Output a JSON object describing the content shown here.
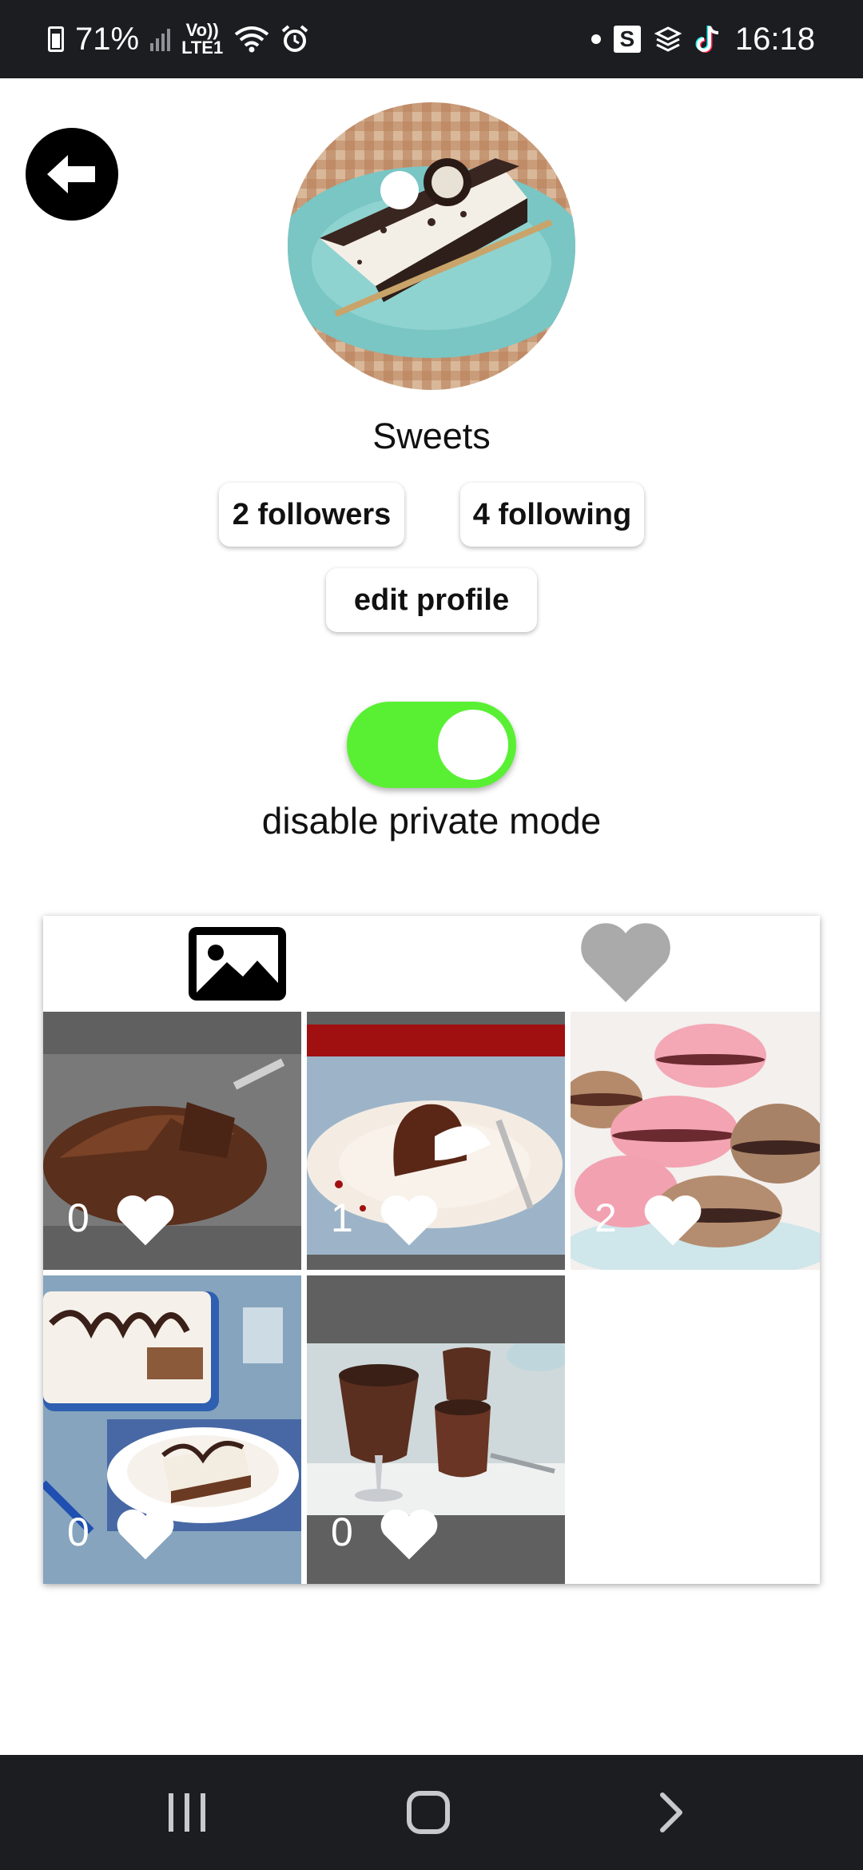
{
  "status_bar": {
    "battery": "71%",
    "volte": "Vo))",
    "lte": "LTE1",
    "clock": "16:18",
    "s_badge": "S"
  },
  "profile": {
    "name": "Sweets",
    "followers_label": "2 followers",
    "following_label": "4 following",
    "edit_profile_label": "edit profile"
  },
  "private_mode": {
    "enabled": true,
    "label": "disable private mode",
    "toggle_color": "#59f033"
  },
  "gallery": {
    "tabs": [
      {
        "icon": "image-icon",
        "active": true
      },
      {
        "icon": "heart-icon",
        "active": false
      }
    ],
    "posts": [
      {
        "likes": "0",
        "icon": "heart-icon"
      },
      {
        "likes": "1",
        "icon": "heart-icon"
      },
      {
        "likes": "2",
        "icon": "heart-icon"
      },
      {
        "likes": "0",
        "icon": "heart-icon"
      },
      {
        "likes": "0",
        "icon": "heart-icon"
      }
    ]
  },
  "nav_bar": {
    "buttons": [
      "recent-apps-icon",
      "home-icon",
      "back-icon"
    ]
  }
}
